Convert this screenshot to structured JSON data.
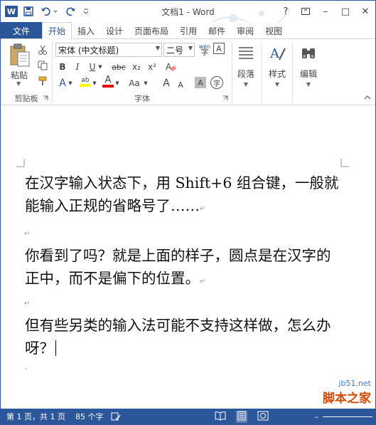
{
  "titlebar": {
    "title": "文档1 - Word",
    "logo_letter": "W",
    "help": "?",
    "minimize": "–",
    "maximize": "□",
    "close": "✕"
  },
  "tabs": {
    "file": "文件",
    "items": [
      "开始",
      "插入",
      "设计",
      "页面布局",
      "引用",
      "邮件",
      "审阅",
      "视图"
    ],
    "active": "开始"
  },
  "ribbon": {
    "clipboard": {
      "paste": "粘贴",
      "label": "剪贴板"
    },
    "font": {
      "font_name": "宋体 (中文标题)",
      "font_size": "二号",
      "wen": "wén",
      "label": "字体",
      "bold": "B",
      "italic": "I",
      "underline": "U",
      "strike": "abc",
      "sub": "x₂",
      "sup": "x²",
      "a_big": "A",
      "a_small": "A",
      "aa": "Aa",
      "a_outline": "A",
      "a_shade": "A",
      "a_box": "A",
      "zi": "字",
      "ab": "ab",
      "font_color_letter": "A",
      "clear": "A"
    },
    "paragraph": {
      "label": "段落"
    },
    "styles": {
      "label": "样式",
      "icon_letter": "A"
    },
    "editing": {
      "label": "编辑"
    }
  },
  "document": {
    "paragraphs": [
      "在汉字输入状态下，用 Shift+6 组合键，一般就能输入正规的省略号了……",
      "你看到了吗？就是上面的样子，圆点是在汉字的正中，而不是偏下的位置。",
      "但有些另类的输入法可能不支持这样做，怎么办呀？"
    ],
    "para_mark": "↵"
  },
  "status": {
    "page": "第 1 页，共 1 页",
    "words": "85 个字"
  },
  "watermark": {
    "url": "jb51.net",
    "name": "脚本之家"
  },
  "colors": {
    "accent": "#2b579a",
    "highlight": "#ffff00",
    "font_red": "#e00000"
  }
}
